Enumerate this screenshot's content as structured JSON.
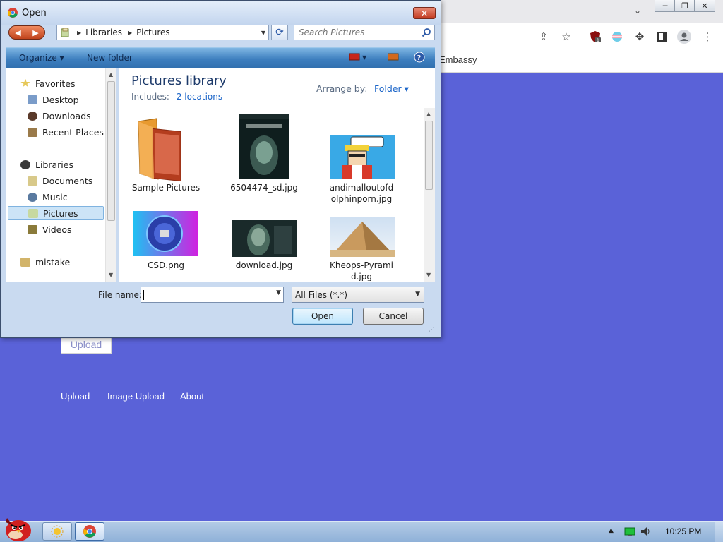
{
  "browser": {
    "bookmark_visible": "Embassy",
    "page": {
      "upload_button": "Upload",
      "links": [
        "Upload",
        "Image Upload",
        "About"
      ]
    }
  },
  "dialog": {
    "title": "Open",
    "close_label": "✕",
    "breadcrumb": [
      "Libraries",
      "Pictures"
    ],
    "search_placeholder": "Search Pictures",
    "commands": {
      "organize": "Organize ▾",
      "new_folder": "New folder"
    },
    "nav": {
      "favorites": "Favorites",
      "favorites_items": [
        "Desktop",
        "Downloads",
        "Recent Places"
      ],
      "libraries": "Libraries",
      "libraries_items": [
        "Documents",
        "Music",
        "Pictures",
        "Videos"
      ],
      "selected": "Pictures",
      "other": "mistake"
    },
    "content": {
      "title": "Pictures library",
      "includes_label": "Includes:",
      "includes_link": "2 locations",
      "arrange_label": "Arrange by:",
      "arrange_value": "Folder ▾",
      "files": [
        {
          "name": "Sample Pictures",
          "kind": "folder-icon"
        },
        {
          "name": "6504474_sd.jpg",
          "kind": "movie-poster"
        },
        {
          "name": "andimalloutofd olphinporn.jpg",
          "kind": "cartoon"
        },
        {
          "name": "CSD.png",
          "kind": "badge"
        },
        {
          "name": "download.jpg",
          "kind": "face"
        },
        {
          "name": "Kheops-Pyrami d.jpg",
          "kind": "pyramid"
        }
      ]
    },
    "bottom": {
      "filename_label": "File name:",
      "filename_value": "",
      "filetype_value": "All Files (*.*)",
      "open_button": "Open",
      "cancel_button": "Cancel"
    }
  },
  "taskbar": {
    "clock": "10:25 PM"
  },
  "colors": {
    "page_background": "#5a62d8",
    "dialog_frame": "#c9daf0",
    "link_blue": "#1a64c8"
  }
}
